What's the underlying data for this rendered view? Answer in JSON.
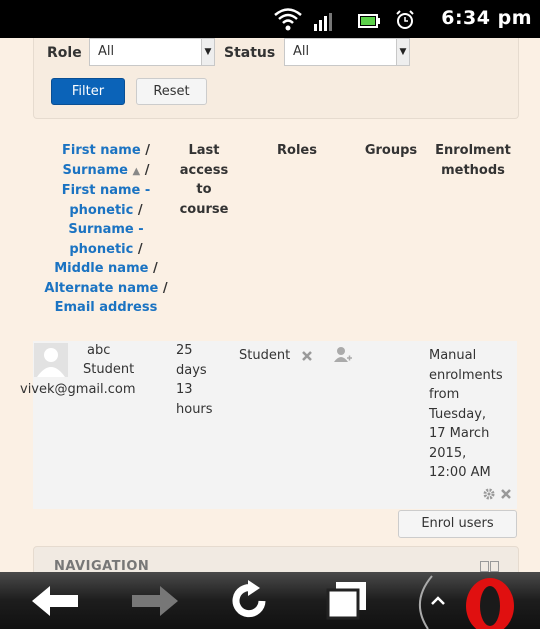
{
  "status_bar": {
    "time": "6:34 pm"
  },
  "filters": {
    "role_label": "Role",
    "role_value": "All",
    "status_label": "Status",
    "status_value": "All",
    "filter_button": "Filter",
    "reset_button": "Reset"
  },
  "table": {
    "headers": {
      "name_parts": [
        "First name",
        "Surname",
        "First name - phonetic",
        "Surname - phonetic",
        "Middle name",
        "Alternate name",
        "Email address"
      ],
      "last_access": "Last access to course",
      "roles": "Roles",
      "groups": "Groups",
      "enrolment": "Enrolment methods"
    },
    "row": {
      "name_line1": "abc",
      "name_line2": "Student",
      "email": "vivek@gmail.com",
      "last_access": [
        "25",
        "days",
        "13",
        "hours"
      ],
      "role": "Student",
      "enrolment": [
        "Manual",
        "enrolments",
        "from",
        "Tuesday,",
        "17 March",
        "2015,",
        "12:00 AM"
      ]
    }
  },
  "enrol_button": "Enrol users",
  "navigation": {
    "title": "NAVIGATION"
  },
  "icons": [
    "wifi-icon",
    "signal-icon",
    "battery-icon",
    "alarm-icon",
    "back-icon",
    "forward-icon",
    "reload-icon",
    "tabs-icon",
    "opera-icon"
  ]
}
